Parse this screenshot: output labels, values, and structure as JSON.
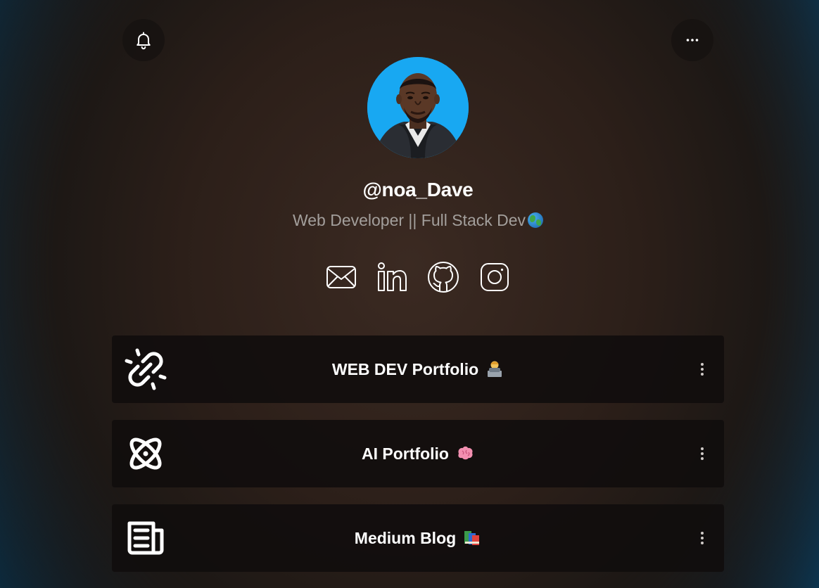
{
  "header": {
    "bell_icon": "bell-icon",
    "more_icon": "more-horizontal-icon"
  },
  "profile": {
    "username": "@noa_Dave",
    "bio": "Web Developer || Full Stack Dev",
    "bio_emoji": "globe-icon",
    "avatar_bg": "#18a8f2"
  },
  "socials": [
    {
      "icon": "email-icon"
    },
    {
      "icon": "linkedin-icon"
    },
    {
      "icon": "github-icon"
    },
    {
      "icon": "instagram-icon"
    }
  ],
  "links": [
    {
      "title": "WEB DEV Portfolio",
      "thumb_icon": "link-icon",
      "emoji": "technologist-emoji"
    },
    {
      "title": "AI Portfolio",
      "thumb_icon": "atom-icon",
      "emoji": "brain-emoji"
    },
    {
      "title": "Medium Blog",
      "thumb_icon": "newspaper-icon",
      "emoji": "books-emoji"
    }
  ],
  "colors": {
    "text": "#ffffff",
    "bio_text": "#a39f9c",
    "card_bg": "#100d0c"
  }
}
